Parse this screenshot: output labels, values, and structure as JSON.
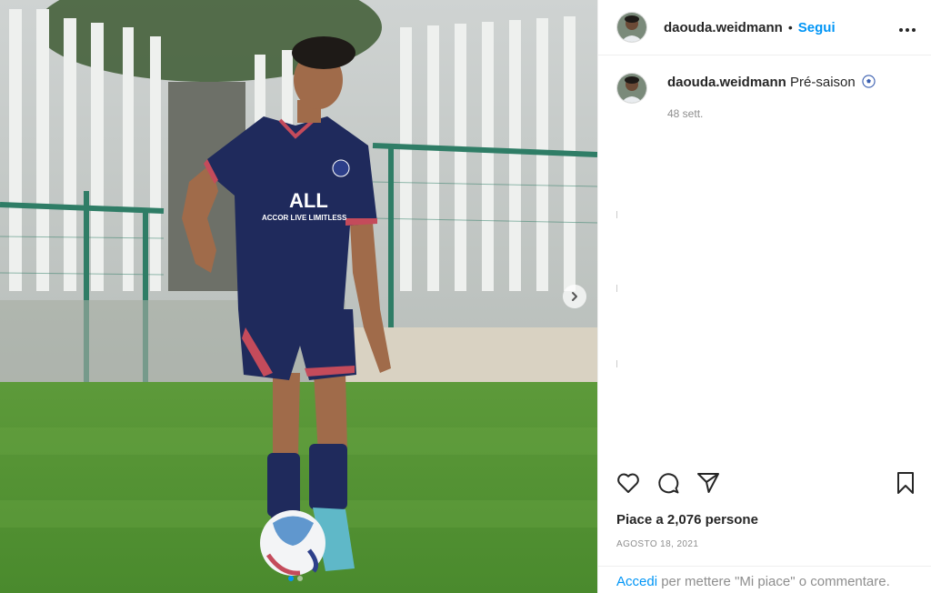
{
  "post": {
    "username": "daouda.weidmann",
    "separator": "•",
    "follow_label": "Segui",
    "more_icon": "more-horizontal-icon"
  },
  "caption": {
    "username": "daouda.weidmann",
    "text": "Pré-saison",
    "emoji_icon": "soccer-ball-icon",
    "time": "48 sett."
  },
  "actions": {
    "like_icon": "heart-icon",
    "comment_icon": "comment-icon",
    "share_icon": "share-icon",
    "save_icon": "bookmark-icon"
  },
  "likes_text": "Piace a 2,076 persone",
  "date": "AGOSTO 18, 2021",
  "footer": {
    "login_label": "Accedi",
    "rest": " per mettere \"Mi piace\" o commentare."
  },
  "media": {
    "next_icon": "chevron-right-icon",
    "carousel_total": 2,
    "carousel_current": 1,
    "shirt_sponsor": "ALL",
    "shirt_sponsor_sub": "ACCOR LIVE LIMITLESS"
  },
  "colors": {
    "accent": "#0095f6",
    "text": "#262626",
    "muted": "#8e8e8e",
    "jersey": "#1f2a5c"
  }
}
